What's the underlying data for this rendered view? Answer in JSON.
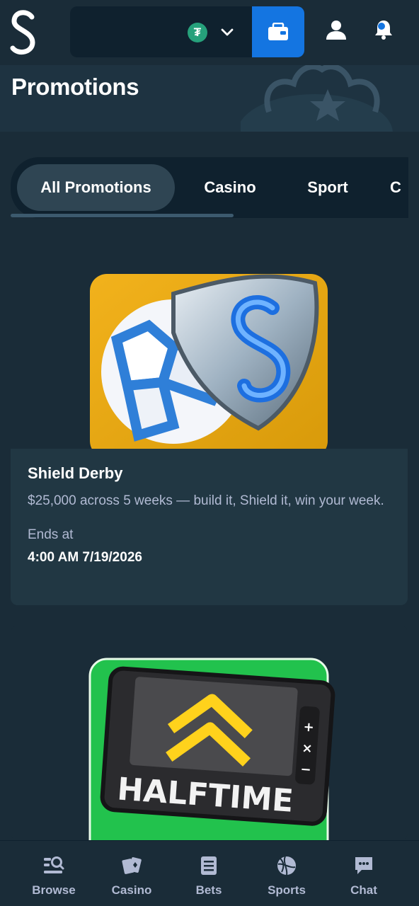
{
  "header": {
    "logo_letter": "S",
    "currency_symbol": "₮",
    "icons": [
      "tether-icon",
      "chevron-down-icon",
      "wallet-icon",
      "user-icon",
      "bell-icon"
    ]
  },
  "page": {
    "title": "Promotions"
  },
  "tabs": [
    {
      "label": "All Promotions",
      "active": true
    },
    {
      "label": "Casino",
      "active": false
    },
    {
      "label": "Sport",
      "active": false
    },
    {
      "label": "C",
      "active": false
    }
  ],
  "promotions": [
    {
      "title": "Shield Derby",
      "description": "$25,000 across 5 weeks — build it, Shield it, win your week.",
      "ends_label": "Ends at",
      "ends_value": "4:00 AM 7/19/2026",
      "image_icon": "shield-football-icon"
    },
    {
      "image_text": "HALFTIME",
      "image_icon": "halftime-board-icon"
    }
  ],
  "bottom_nav": [
    {
      "label": "Browse",
      "icon": "browse-icon"
    },
    {
      "label": "Casino",
      "icon": "casino-icon"
    },
    {
      "label": "Bets",
      "icon": "bets-icon"
    },
    {
      "label": "Sports",
      "icon": "sports-icon"
    },
    {
      "label": "Chat",
      "icon": "chat-icon"
    }
  ],
  "colors": {
    "background": "#1a2c38",
    "panel": "#0f212e",
    "card": "#213743",
    "accent_blue": "#1475e1",
    "text_muted": "#b1bad3",
    "tether_green": "#26a17b"
  }
}
